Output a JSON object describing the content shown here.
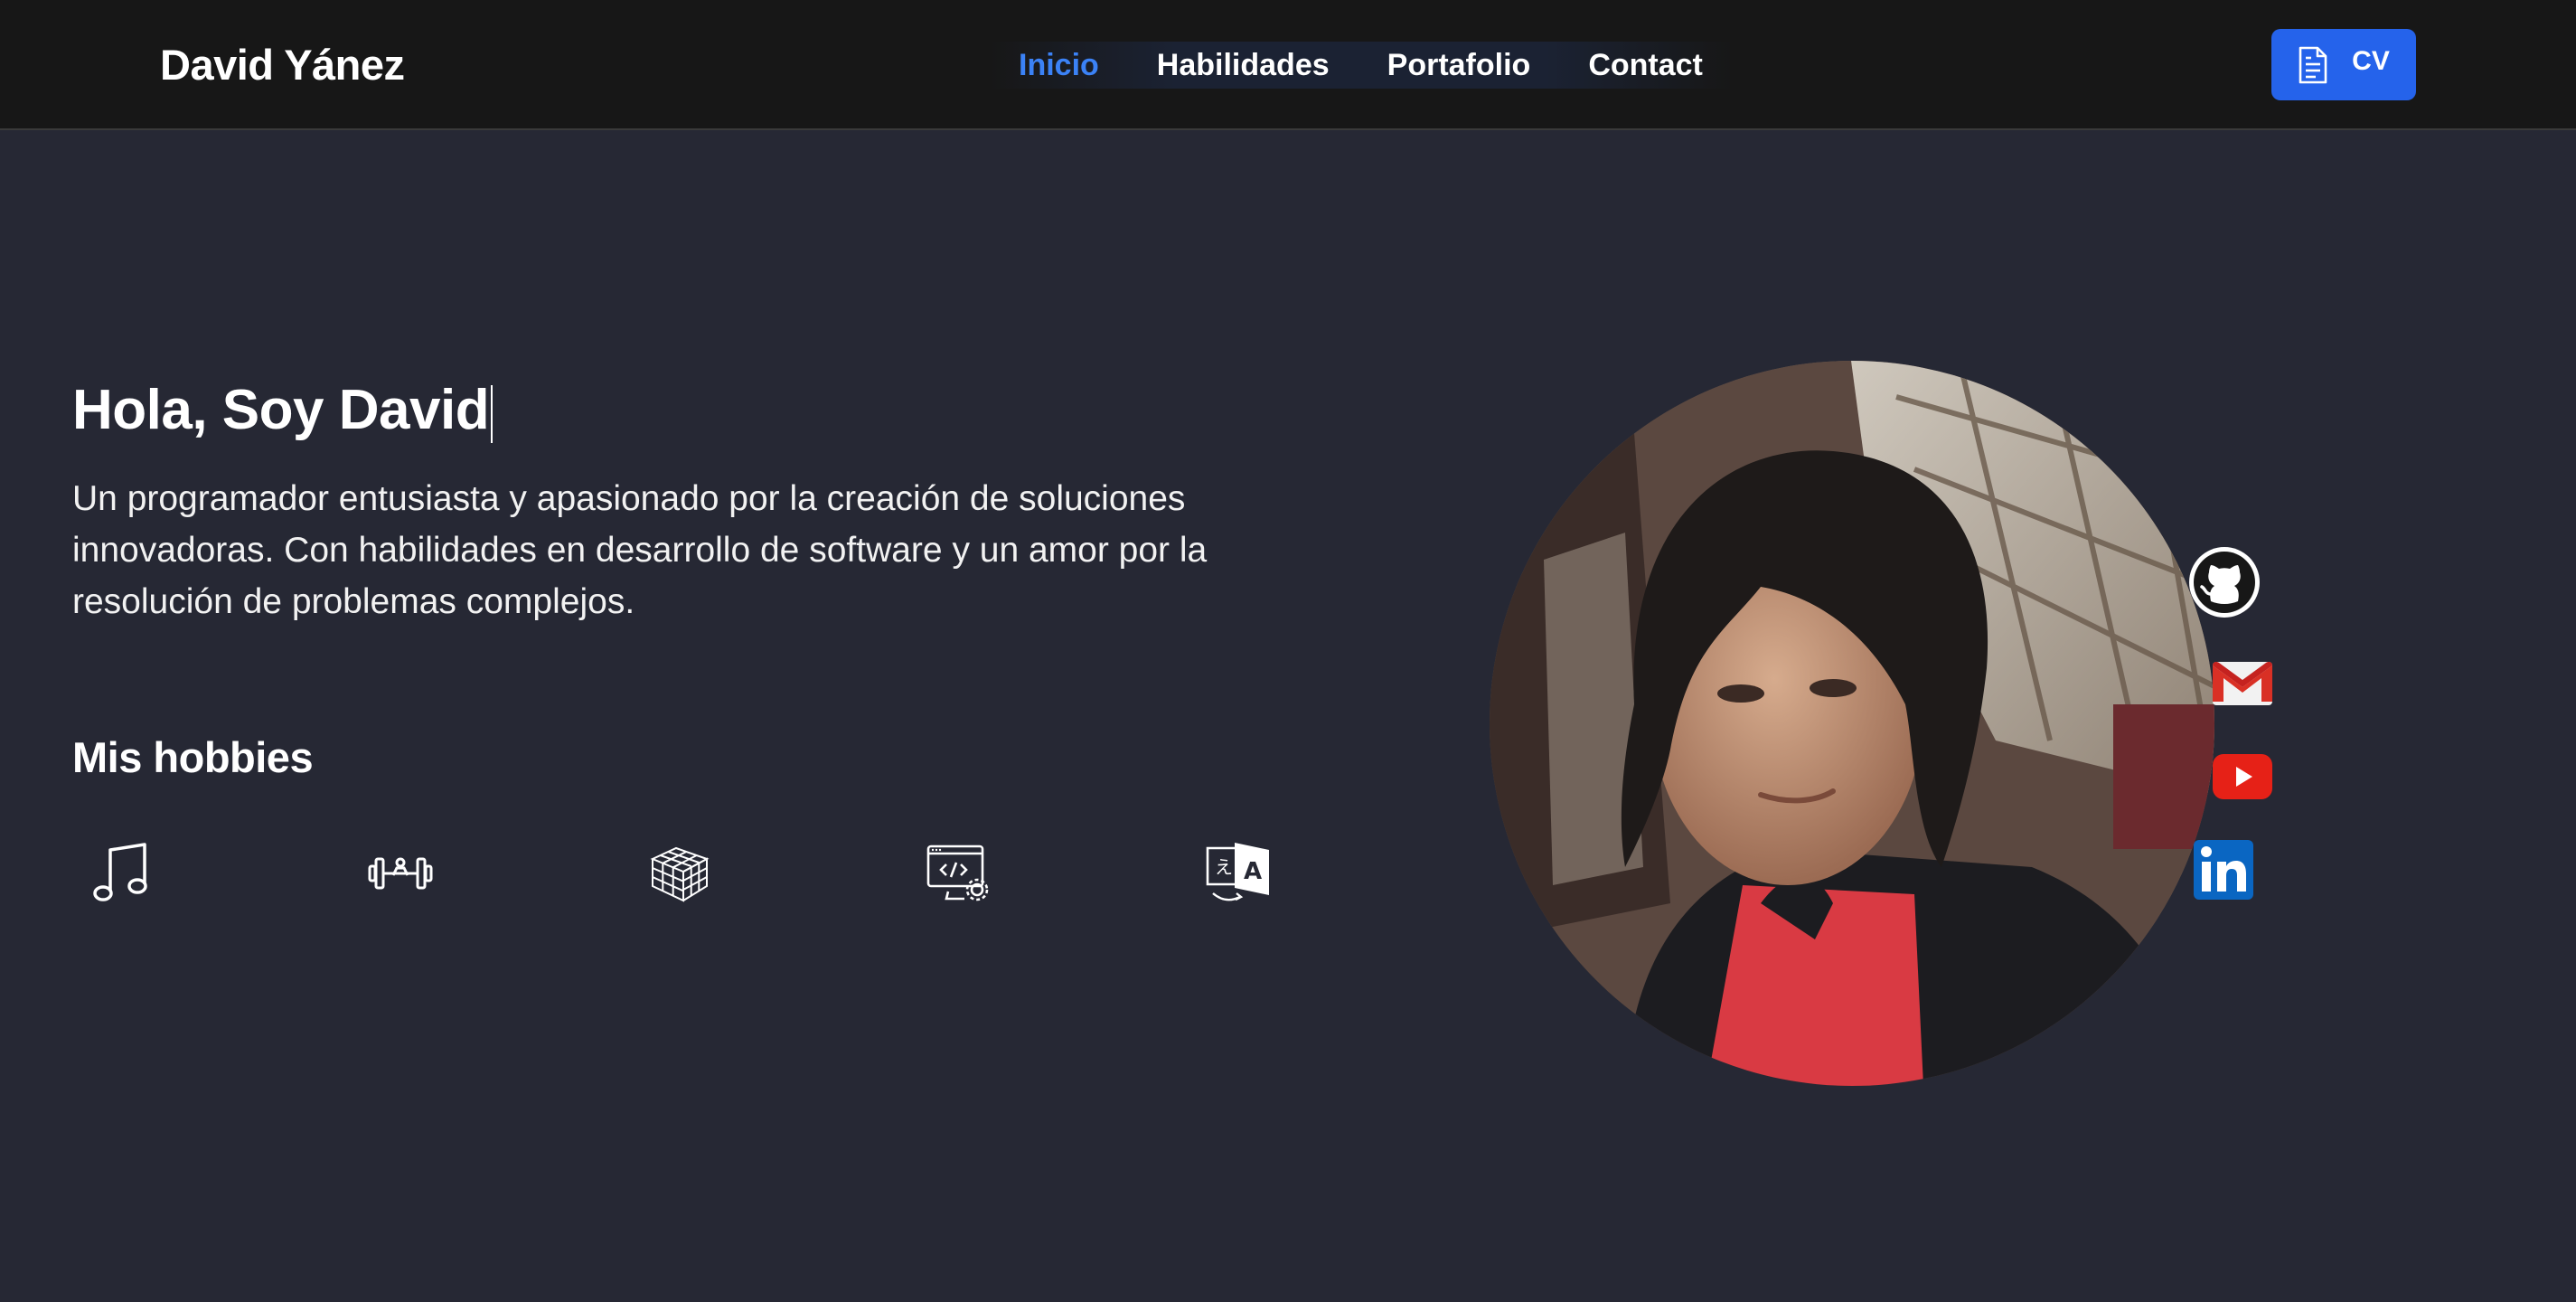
{
  "navbar": {
    "brand": "David Yánez",
    "links": [
      {
        "label": "Inicio",
        "active": true
      },
      {
        "label": "Habilidades",
        "active": false
      },
      {
        "label": "Portafolio",
        "active": false
      },
      {
        "label": "Contact",
        "active": false
      }
    ],
    "cv_button": {
      "label": "CV",
      "icon": "document-icon"
    }
  },
  "hero": {
    "title": "Hola, Soy David",
    "description": "Un programador entusiasta y apasionado por la creación de soluciones innovadoras. Con habilidades en desarrollo de software y un amor por la resolución de problemas complejos."
  },
  "hobbies": {
    "title": "Mis hobbies",
    "items": [
      {
        "icon": "music-note-icon"
      },
      {
        "icon": "dumbbell-icon"
      },
      {
        "icon": "rubiks-cube-icon"
      },
      {
        "icon": "computer-code-icon"
      },
      {
        "icon": "translate-icon"
      }
    ]
  },
  "social": [
    {
      "icon": "github-icon"
    },
    {
      "icon": "gmail-icon"
    },
    {
      "icon": "youtube-icon"
    },
    {
      "icon": "linkedin-icon"
    }
  ],
  "colors": {
    "background": "#262834",
    "navbar": "#171717",
    "accent": "#3b82f6",
    "cv_button": "#2563eb"
  }
}
